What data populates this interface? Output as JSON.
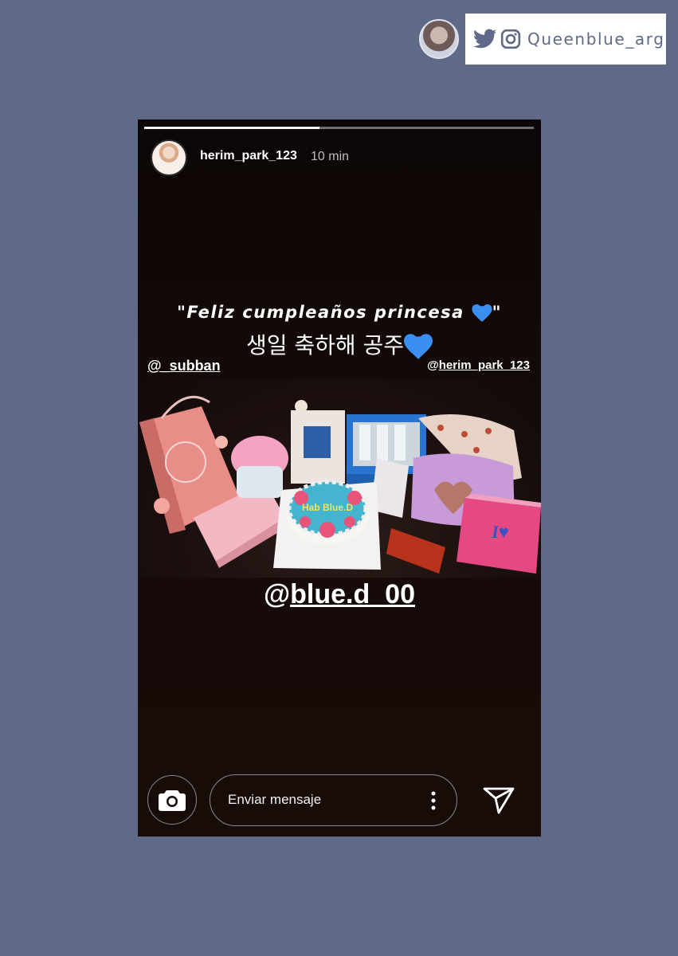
{
  "watermark": {
    "handle": "Queenblue_arg",
    "icons": [
      "twitter-icon",
      "instagram-icon"
    ],
    "color": "#5e6a88"
  },
  "story": {
    "progress": 0.45,
    "username": "herim_park_123",
    "time": "10 min",
    "caption_es": "\"Feliz cumpleaños princesa ",
    "caption_es_end": "\"",
    "caption_ko": "생일 축하해 공주",
    "tag_left": "@_subban",
    "tag_right_at": "@",
    "tag_right_name": "herim_park_123",
    "mention_at": "@",
    "mention_name": "blue.d_00",
    "message_placeholder": "Enviar mensaje",
    "heart_color": "#3a8ff0",
    "photo_cake_text": "Hab Blue.D"
  }
}
